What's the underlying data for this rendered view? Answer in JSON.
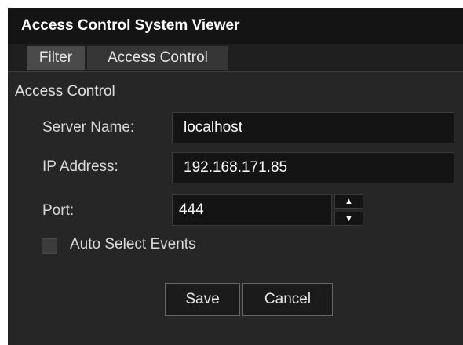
{
  "window": {
    "title": "Access Control System Viewer"
  },
  "tabs": [
    {
      "label": "Filter"
    },
    {
      "label": "Access Control"
    }
  ],
  "section": {
    "title": "Access Control"
  },
  "form": {
    "server_name": {
      "label": "Server Name:",
      "value": "localhost"
    },
    "ip_address": {
      "label": "IP Address:",
      "value": "192.168.171.85"
    },
    "port": {
      "label": "Port:",
      "value": "444",
      "up_glyph": "▲",
      "down_glyph": "▼"
    },
    "auto_select": {
      "label": "Auto Select Events",
      "checked": false
    }
  },
  "buttons": {
    "save_label": "Save",
    "cancel_label": "Cancel"
  },
  "colors": {
    "window_bg": "#262626",
    "titlebar_bg": "#141414",
    "input_bg": "#141414",
    "tab_active_bg": "#4a4a4a"
  }
}
